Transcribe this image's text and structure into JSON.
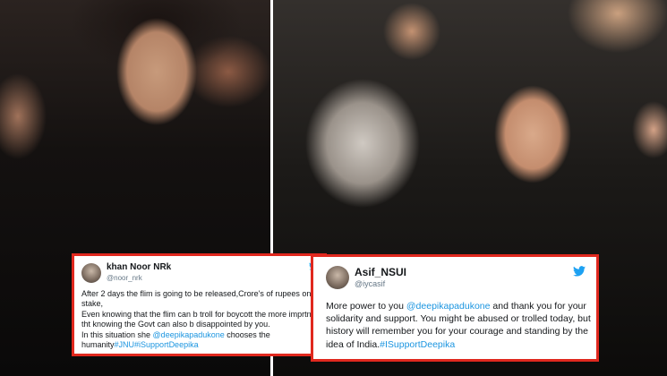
{
  "tweets": [
    {
      "name": "khan Noor NRk",
      "handle": "@noor_nrk",
      "avatar": "avatar",
      "icon": "twitter-bird-icon",
      "body_before": "After 2 days the flim is going to be released,Crore's of rupees on stake,\nEven knowing that the flim can b troll for boycott the more imprtnt is tht knowing the Govt can also b disappointed by you.\nIn this situation she ",
      "mention": "@deepikapadukone",
      "body_middle": " chooses the humanity",
      "hashtags": "#JNU#iSupportDeepika"
    },
    {
      "name": "Asif_NSUI",
      "handle": "@iycasif",
      "avatar": "avatar",
      "icon": "twitter-bird-icon",
      "body_before": "More power to you ",
      "mention": "@deepikapadukone",
      "body_middle": " and thank you for your solidarity and support. You might be abused or trolled today, but history will remember you for your courage and standing by the idea of India.",
      "hashtags": "#ISupportDeepika"
    }
  ],
  "colors": {
    "border": "#e0281e",
    "link": "#1b95e0",
    "handle": "#657786"
  }
}
